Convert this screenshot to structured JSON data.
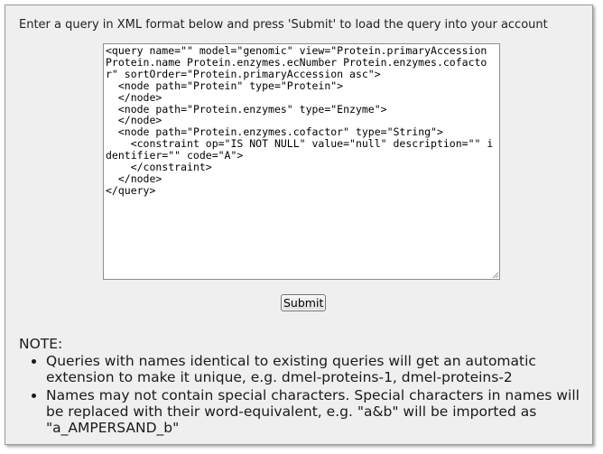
{
  "intro": "Enter a query in XML format below and press 'Submit' to load the query into your account",
  "query_xml": "<query name=\"\" model=\"genomic\" view=\"Protein.primaryAccession Protein.name Protein.enzymes.ecNumber Protein.enzymes.cofactor\" sortOrder=\"Protein.primaryAccession asc\">\n  <node path=\"Protein\" type=\"Protein\">\n  </node>\n  <node path=\"Protein.enzymes\" type=\"Enzyme\">\n  </node>\n  <node path=\"Protein.enzymes.cofactor\" type=\"String\">\n    <constraint op=\"IS NOT NULL\" value=\"null\" description=\"\" identifier=\"\" code=\"A\">\n    </constraint>\n  </node>\n</query>",
  "submit_label": "Submit",
  "note": {
    "title": "NOTE:",
    "items": [
      "Queries with names identical to existing queries will get an automatic extension to make it unique, e.g. dmel-proteins-1, dmel-proteins-2",
      "Names may not contain special characters. Special characters in names will be replaced with their word-equivalent, e.g. \"a&b\" will be imported as \"a_AMPERSAND_b\""
    ]
  }
}
